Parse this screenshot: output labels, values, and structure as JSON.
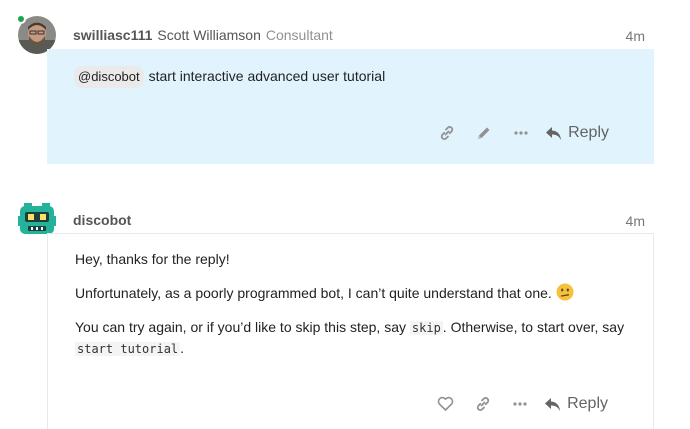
{
  "posts": [
    {
      "username": "swilliasc111",
      "full_name": "Scott Williamson",
      "user_title": "Consultant",
      "age": "4m",
      "mention": "@discobot",
      "text": "start interactive advanced user tutorial",
      "reply_label": "Reply",
      "highlight_color": "#e1f3fd",
      "online_color": "#1ca551"
    },
    {
      "username": "discobot",
      "age": "4m",
      "para1": "Hey, thanks for the reply!",
      "para2": "Unfortunately, as a poorly programmed bot, I can’t quite understand that one.",
      "para3_a": "You can try again, or if you’d like to skip this step, say ",
      "para3_code1": "skip",
      "para3_b": ". Otherwise, to start over, say ",
      "para3_code2": "start tutorial",
      "para3_c": ".",
      "reply_label": "Reply",
      "avatar_color": "#25b29b"
    }
  ]
}
